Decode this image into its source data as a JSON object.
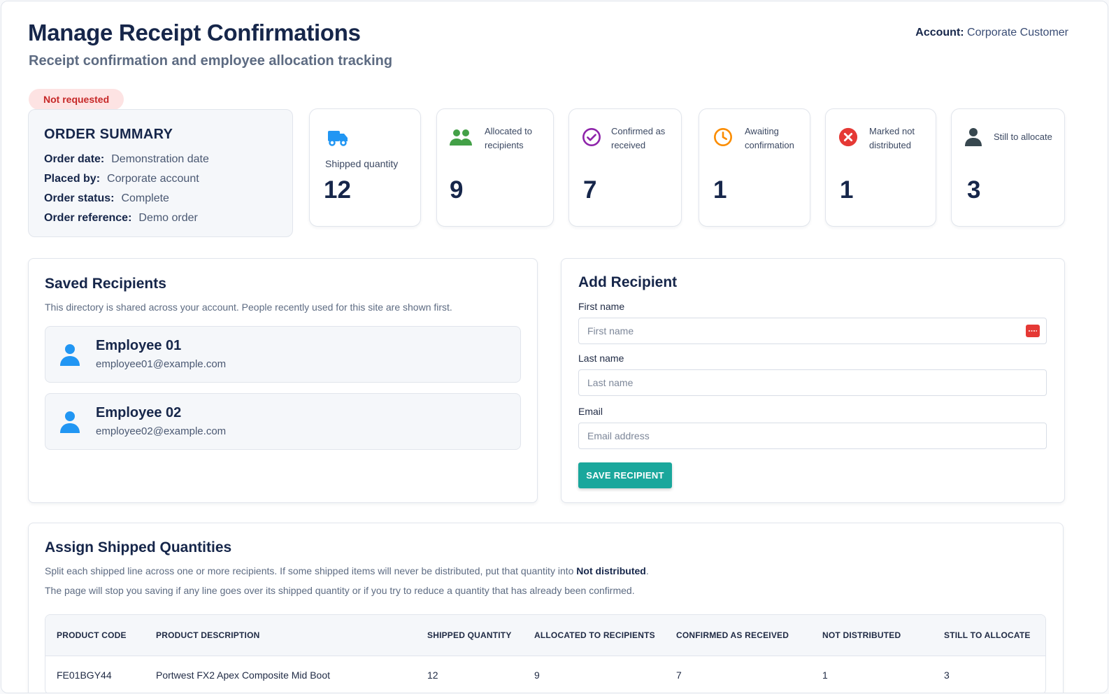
{
  "header": {
    "title": "Manage Receipt Confirmations",
    "subtitle": "Receipt confirmation and employee allocation tracking",
    "account_label": "Account:",
    "account_value": "Corporate Customer"
  },
  "status_badge": "Not requested",
  "order_summary": {
    "heading": "ORDER SUMMARY",
    "rows": [
      {
        "label": "Order date:",
        "value": "Demonstration date"
      },
      {
        "label": "Placed by:",
        "value": "Corporate account"
      },
      {
        "label": "Order status:",
        "value": "Complete"
      },
      {
        "label": "Order reference:",
        "value": "Demo order"
      }
    ]
  },
  "stats": [
    {
      "label": "Shipped quantity",
      "value": "12",
      "icon": "truck-icon",
      "color": "#2196f3"
    },
    {
      "label": "Allocated to recipients",
      "value": "9",
      "icon": "people-icon",
      "color": "#43a047"
    },
    {
      "label": "Confirmed as received",
      "value": "7",
      "icon": "check-circle-icon",
      "color": "#8e24aa"
    },
    {
      "label": "Awaiting confirmation",
      "value": "1",
      "icon": "clock-icon",
      "color": "#fb8c00"
    },
    {
      "label": "Marked not distributed",
      "value": "1",
      "icon": "x-circle-icon",
      "color": "#e53935"
    },
    {
      "label": "Still to allocate",
      "value": "3",
      "icon": "person-icon",
      "color": "#37474f"
    }
  ],
  "saved_recipients": {
    "heading": "Saved Recipients",
    "description": "This directory is shared across your account. People recently used for this site are shown first.",
    "items": [
      {
        "name": "Employee 01",
        "email": "employee01@example.com"
      },
      {
        "name": "Employee 02",
        "email": "employee02@example.com"
      }
    ]
  },
  "add_recipient": {
    "heading": "Add Recipient",
    "first_name_label": "First name",
    "first_name_placeholder": "First name",
    "last_name_label": "Last name",
    "last_name_placeholder": "Last name",
    "email_label": "Email",
    "email_placeholder": "Email address",
    "save_label": "SAVE RECIPIENT"
  },
  "assign": {
    "heading": "Assign Shipped Quantities",
    "line1_prefix": "Split each shipped line across one or more recipients. If some shipped items will never be distributed, put that quantity into ",
    "line1_bold": "Not distributed",
    "line1_suffix": ".",
    "line2": "The page will stop you saving if any line goes over its shipped quantity or if you try to reduce a quantity that has already been confirmed.",
    "columns": [
      "PRODUCT CODE",
      "PRODUCT DESCRIPTION",
      "SHIPPED QUANTITY",
      "ALLOCATED TO RECIPIENTS",
      "CONFIRMED AS RECEIVED",
      "NOT DISTRIBUTED",
      "STILL TO ALLOCATE"
    ],
    "rows": [
      [
        "FE01BGY44",
        "Portwest FX2 Apex Composite Mid Boot",
        "12",
        "9",
        "7",
        "1",
        "3"
      ]
    ]
  }
}
